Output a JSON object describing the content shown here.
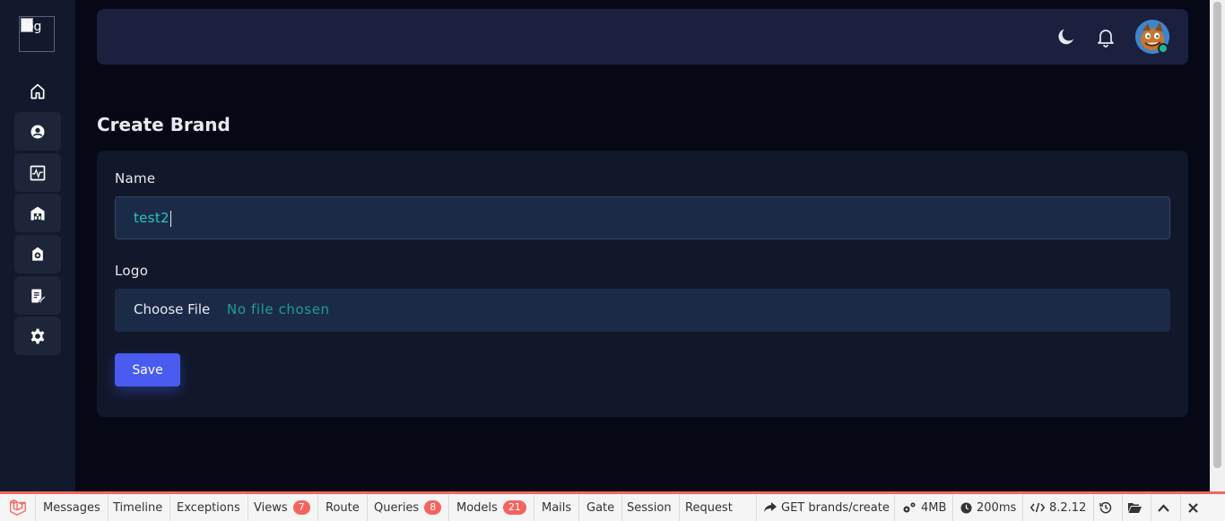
{
  "app": {
    "logo_alt": "log"
  },
  "header": {
    "theme_icon": "moon-icon",
    "notification_icon": "bell-icon",
    "avatar_status_color": "#1fb98a"
  },
  "sidebar": {
    "items": [
      {
        "icon": "home-icon"
      },
      {
        "icon": "user-circle-icon"
      },
      {
        "icon": "activity-monitor-icon"
      },
      {
        "icon": "warehouse-icon"
      },
      {
        "icon": "add-tag-icon"
      },
      {
        "icon": "edit-document-icon"
      },
      {
        "icon": "gear-icon"
      }
    ]
  },
  "page": {
    "title": "Create Brand"
  },
  "form": {
    "name_label": "Name",
    "name_value": "test2",
    "logo_label": "Logo",
    "file_button": "Choose File",
    "file_status": "No file chosen",
    "save_label": "Save"
  },
  "debugbar": {
    "accent": "#f4645f",
    "tabs": [
      {
        "label": "Messages"
      },
      {
        "label": "Timeline"
      },
      {
        "label": "Exceptions"
      },
      {
        "label": "Views",
        "count": "7"
      },
      {
        "label": "Route"
      },
      {
        "label": "Queries",
        "count": "8"
      },
      {
        "label": "Models",
        "count": "21"
      },
      {
        "label": "Mails"
      },
      {
        "label": "Gate"
      },
      {
        "label": "Session"
      },
      {
        "label": "Request"
      }
    ],
    "request": "GET brands/create",
    "memory": "4MB",
    "time": "200ms",
    "php_version": "8.2.12"
  }
}
